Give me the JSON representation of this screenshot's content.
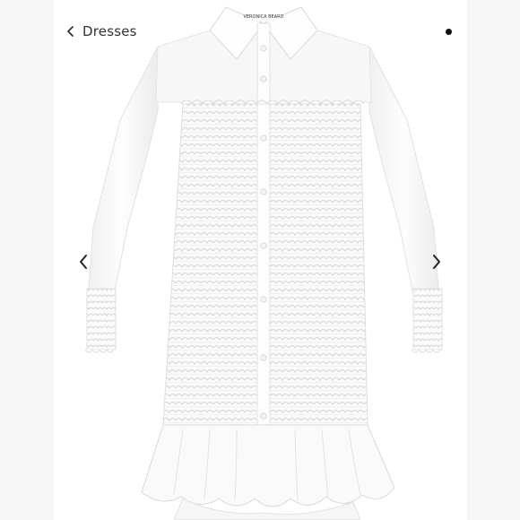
{
  "header": {
    "back_label": "Dresses",
    "back_icon": "chevron-left-icon",
    "menu_icon": "dot-icon"
  },
  "gallery": {
    "prev_icon": "chevron-left-icon",
    "next_icon": "chevron-right-icon"
  },
  "product_image": {
    "label_text": "VERONICA BEARD",
    "color": "#ffffff"
  }
}
